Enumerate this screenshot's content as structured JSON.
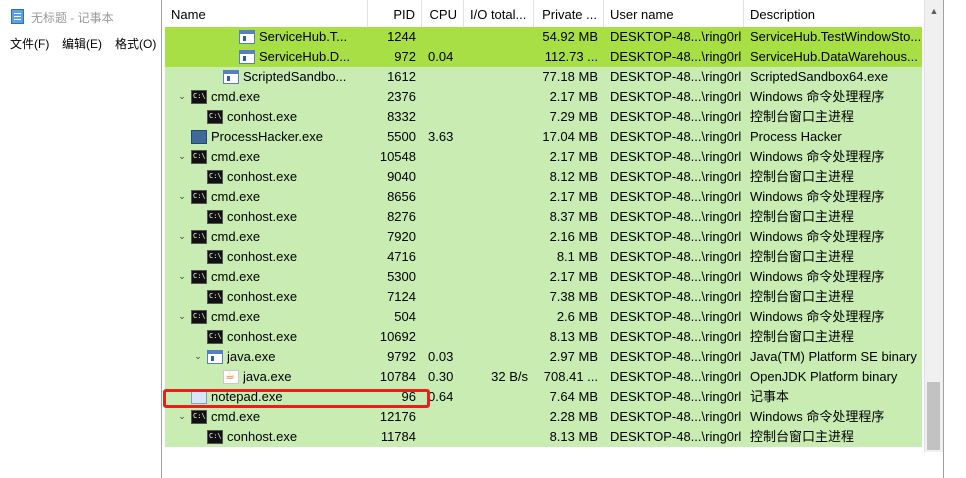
{
  "notepad": {
    "title": "无标题 - 记事本",
    "menus": [
      "文件(F)",
      "编辑(E)",
      "格式(O)"
    ]
  },
  "columns": [
    "Name",
    "PID",
    "CPU",
    "I/O total...",
    "Private ...",
    "User name",
    "Description"
  ],
  "rows": [
    {
      "indent": 4,
      "twisty": "",
      "icon": "window-icon",
      "name": "ServiceHub.T...",
      "pid": "1244",
      "cpu": "",
      "io": "",
      "priv": "54.92 MB",
      "user": "DESKTOP-48...\\ring0rl",
      "desc": "ServiceHub.TestWindowSto...",
      "highlight": true
    },
    {
      "indent": 4,
      "twisty": "",
      "icon": "window-icon",
      "name": "ServiceHub.D...",
      "pid": "972",
      "cpu": "0.04",
      "io": "",
      "priv": "112.73 ...",
      "user": "DESKTOP-48...\\ring0rl",
      "desc": "ServiceHub.DataWarehous...",
      "highlight": true
    },
    {
      "indent": 3,
      "twisty": "",
      "icon": "window-icon",
      "name": "ScriptedSandbo...",
      "pid": "1612",
      "cpu": "",
      "io": "",
      "priv": "77.18 MB",
      "user": "DESKTOP-48...\\ring0rl",
      "desc": "ScriptedSandbox64.exe",
      "highlight": false
    },
    {
      "indent": 1,
      "twisty": "v",
      "icon": "cmd-icon",
      "name": "cmd.exe",
      "pid": "2376",
      "cpu": "",
      "io": "",
      "priv": "2.17 MB",
      "user": "DESKTOP-48...\\ring0rl",
      "desc": "Windows 命令处理程序",
      "highlight": false
    },
    {
      "indent": 2,
      "twisty": "",
      "icon": "cmd-icon",
      "name": "conhost.exe",
      "pid": "8332",
      "cpu": "",
      "io": "",
      "priv": "7.29 MB",
      "user": "DESKTOP-48...\\ring0rl",
      "desc": "控制台窗口主进程",
      "highlight": false
    },
    {
      "indent": 1,
      "twisty": "",
      "icon": "processhacker-icon",
      "name": "ProcessHacker.exe",
      "pid": "5500",
      "cpu": "3.63",
      "io": "",
      "priv": "17.04 MB",
      "user": "DESKTOP-48...\\ring0rl",
      "desc": "Process Hacker",
      "highlight": false
    },
    {
      "indent": 1,
      "twisty": "v",
      "icon": "cmd-icon",
      "name": "cmd.exe",
      "pid": "10548",
      "cpu": "",
      "io": "",
      "priv": "2.17 MB",
      "user": "DESKTOP-48...\\ring0rl",
      "desc": "Windows 命令处理程序",
      "highlight": false
    },
    {
      "indent": 2,
      "twisty": "",
      "icon": "cmd-icon",
      "name": "conhost.exe",
      "pid": "9040",
      "cpu": "",
      "io": "",
      "priv": "8.12 MB",
      "user": "DESKTOP-48...\\ring0rl",
      "desc": "控制台窗口主进程",
      "highlight": false
    },
    {
      "indent": 1,
      "twisty": "v",
      "icon": "cmd-icon",
      "name": "cmd.exe",
      "pid": "8656",
      "cpu": "",
      "io": "",
      "priv": "2.17 MB",
      "user": "DESKTOP-48...\\ring0rl",
      "desc": "Windows 命令处理程序",
      "highlight": false
    },
    {
      "indent": 2,
      "twisty": "",
      "icon": "cmd-icon",
      "name": "conhost.exe",
      "pid": "8276",
      "cpu": "",
      "io": "",
      "priv": "8.37 MB",
      "user": "DESKTOP-48...\\ring0rl",
      "desc": "控制台窗口主进程",
      "highlight": false
    },
    {
      "indent": 1,
      "twisty": "v",
      "icon": "cmd-icon",
      "name": "cmd.exe",
      "pid": "7920",
      "cpu": "",
      "io": "",
      "priv": "2.16 MB",
      "user": "DESKTOP-48...\\ring0rl",
      "desc": "Windows 命令处理程序",
      "highlight": false
    },
    {
      "indent": 2,
      "twisty": "",
      "icon": "cmd-icon",
      "name": "conhost.exe",
      "pid": "4716",
      "cpu": "",
      "io": "",
      "priv": "8.1 MB",
      "user": "DESKTOP-48...\\ring0rl",
      "desc": "控制台窗口主进程",
      "highlight": false
    },
    {
      "indent": 1,
      "twisty": "v",
      "icon": "cmd-icon",
      "name": "cmd.exe",
      "pid": "5300",
      "cpu": "",
      "io": "",
      "priv": "2.17 MB",
      "user": "DESKTOP-48...\\ring0rl",
      "desc": "Windows 命令处理程序",
      "highlight": false
    },
    {
      "indent": 2,
      "twisty": "",
      "icon": "cmd-icon",
      "name": "conhost.exe",
      "pid": "7124",
      "cpu": "",
      "io": "",
      "priv": "7.38 MB",
      "user": "DESKTOP-48...\\ring0rl",
      "desc": "控制台窗口主进程",
      "highlight": false
    },
    {
      "indent": 1,
      "twisty": "v",
      "icon": "cmd-icon",
      "name": "cmd.exe",
      "pid": "504",
      "cpu": "",
      "io": "",
      "priv": "2.6 MB",
      "user": "DESKTOP-48...\\ring0rl",
      "desc": "Windows 命令处理程序",
      "highlight": false
    },
    {
      "indent": 2,
      "twisty": "",
      "icon": "cmd-icon",
      "name": "conhost.exe",
      "pid": "10692",
      "cpu": "",
      "io": "",
      "priv": "8.13 MB",
      "user": "DESKTOP-48...\\ring0rl",
      "desc": "控制台窗口主进程",
      "highlight": false
    },
    {
      "indent": 2,
      "twisty": "v",
      "icon": "window-icon",
      "name": "java.exe",
      "pid": "9792",
      "cpu": "0.03",
      "io": "",
      "priv": "2.97 MB",
      "user": "DESKTOP-48...\\ring0rl",
      "desc": "Java(TM) Platform SE binary",
      "highlight": false
    },
    {
      "indent": 3,
      "twisty": "",
      "icon": "java-icon",
      "name": "java.exe",
      "pid": "10784",
      "cpu": "0.30",
      "io": "32 B/s",
      "priv": "708.41 ...",
      "user": "DESKTOP-48...\\ring0rl",
      "desc": "OpenJDK Platform binary",
      "highlight": false
    },
    {
      "indent": 1,
      "twisty": "",
      "icon": "notepad-icon",
      "name": "notepad.exe",
      "pid": "96",
      "cpu": "0.64",
      "io": "",
      "priv": "7.64 MB",
      "user": "DESKTOP-48...\\ring0rl",
      "desc": "记事本",
      "highlight": false
    },
    {
      "indent": 1,
      "twisty": "v",
      "icon": "cmd-icon",
      "name": "cmd.exe",
      "pid": "12176",
      "cpu": "",
      "io": "",
      "priv": "2.28 MB",
      "user": "DESKTOP-48...\\ring0rl",
      "desc": "Windows 命令处理程序",
      "highlight": false
    },
    {
      "indent": 2,
      "twisty": "",
      "icon": "cmd-icon",
      "name": "conhost.exe",
      "pid": "11784",
      "cpu": "",
      "io": "",
      "priv": "8.13 MB",
      "user": "DESKTOP-48...\\ring0rl",
      "desc": "控制台窗口主进程",
      "highlight": false
    }
  ],
  "colors": {
    "row": "#c9ecb3",
    "highlight": "#a8df45",
    "annotation": "#e8201c"
  }
}
